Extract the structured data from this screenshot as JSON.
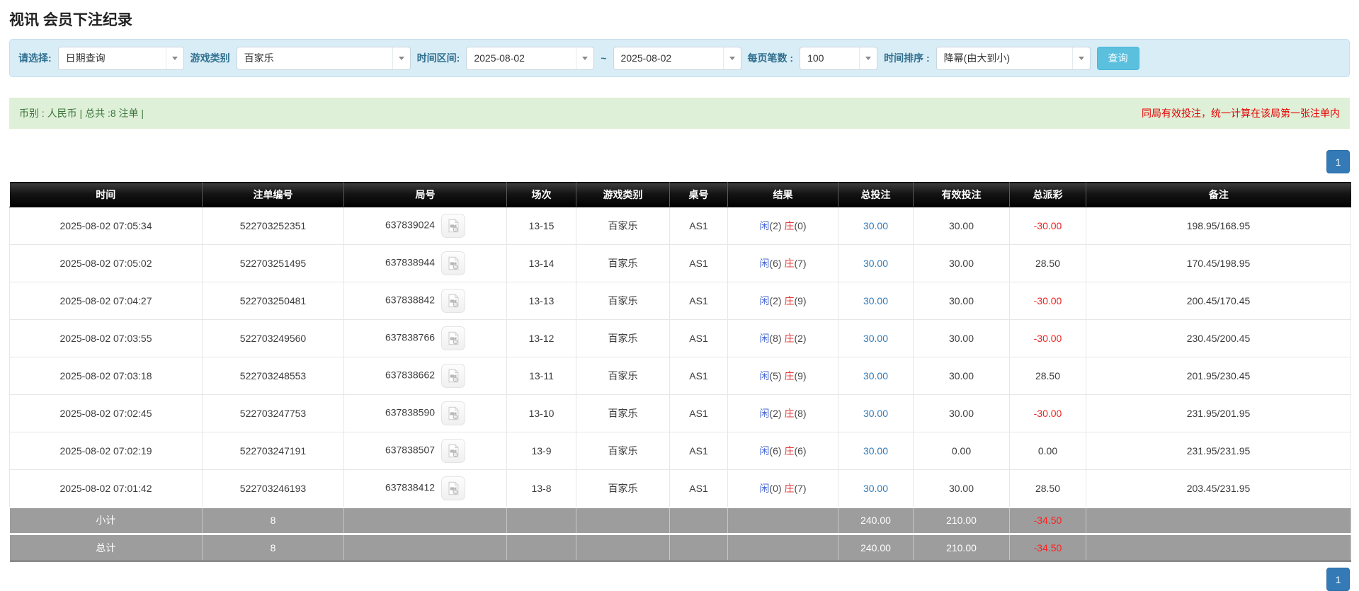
{
  "page": {
    "title": "视讯 会员下注纪录"
  },
  "filters": {
    "query_type_label": "请选择:",
    "query_type_value": "日期查询",
    "game_category_label": "游戏类别",
    "game_category_value": "百家乐",
    "time_range_label": "时间区间:",
    "date_from": "2025-08-02",
    "range_separator": "~",
    "date_to": "2025-08-02",
    "page_size_label": "每页笔数 :",
    "page_size_value": "100",
    "time_sort_label": "时间排序 :",
    "time_sort_value": "降幂(由大到小)",
    "search_button_label": "查询"
  },
  "summary_bar": {
    "left_text": "币别 : 人民币 | 总共 :8 注单 |",
    "right_notice": "同局有效投注，统一计算在该局第一张注单内"
  },
  "pagination": {
    "page": "1"
  },
  "icons": {
    "combo_arrow": "chevron-down-icon",
    "round_video": "video-file-icon"
  },
  "colors": {
    "filter_bar_bg": "#d9edf7",
    "filter_label": "#31708f",
    "search_button_bg": "#5bc0de",
    "summary_bg": "#dff0d8",
    "summary_text": "#3c763d",
    "notice_red": "#e60000",
    "header_bg": "#000000",
    "link_blue": "#337ab7",
    "player_blue": "#4466d6",
    "banker_red": "#e03b3b",
    "negative_red": "#ee2222",
    "footer_bg": "#9d9d9d",
    "pagination_blue": "#337ab7"
  },
  "table": {
    "headers": [
      "时间",
      "注单编号",
      "局号",
      "场次",
      "游戏类别",
      "桌号",
      "结果",
      "总投注",
      "有效投注",
      "总派彩",
      "备注"
    ],
    "rows": [
      {
        "time": "2025-08-02 07:05:34",
        "bet_id": "522703252351",
        "round_id": "637839024",
        "session": "13-15",
        "game": "百家乐",
        "table": "AS1",
        "player_label": "闲",
        "player_score": "(2)",
        "banker_label": "庄",
        "banker_score": "(0)",
        "total_bet": "30.00",
        "valid_bet": "30.00",
        "payout": "-30.00",
        "payout_negative": true,
        "remark": "198.95/168.95"
      },
      {
        "time": "2025-08-02 07:05:02",
        "bet_id": "522703251495",
        "round_id": "637838944",
        "session": "13-14",
        "game": "百家乐",
        "table": "AS1",
        "player_label": "闲",
        "player_score": "(6)",
        "banker_label": "庄",
        "banker_score": "(7)",
        "total_bet": "30.00",
        "valid_bet": "30.00",
        "payout": "28.50",
        "payout_negative": false,
        "remark": "170.45/198.95"
      },
      {
        "time": "2025-08-02 07:04:27",
        "bet_id": "522703250481",
        "round_id": "637838842",
        "session": "13-13",
        "game": "百家乐",
        "table": "AS1",
        "player_label": "闲",
        "player_score": "(2)",
        "banker_label": "庄",
        "banker_score": "(9)",
        "total_bet": "30.00",
        "valid_bet": "30.00",
        "payout": "-30.00",
        "payout_negative": true,
        "remark": "200.45/170.45"
      },
      {
        "time": "2025-08-02 07:03:55",
        "bet_id": "522703249560",
        "round_id": "637838766",
        "session": "13-12",
        "game": "百家乐",
        "table": "AS1",
        "player_label": "闲",
        "player_score": "(8)",
        "banker_label": "庄",
        "banker_score": "(2)",
        "total_bet": "30.00",
        "valid_bet": "30.00",
        "payout": "-30.00",
        "payout_negative": true,
        "remark": "230.45/200.45"
      },
      {
        "time": "2025-08-02 07:03:18",
        "bet_id": "522703248553",
        "round_id": "637838662",
        "session": "13-11",
        "game": "百家乐",
        "table": "AS1",
        "player_label": "闲",
        "player_score": "(5)",
        "banker_label": "庄",
        "banker_score": "(9)",
        "total_bet": "30.00",
        "valid_bet": "30.00",
        "payout": "28.50",
        "payout_negative": false,
        "remark": "201.95/230.45"
      },
      {
        "time": "2025-08-02 07:02:45",
        "bet_id": "522703247753",
        "round_id": "637838590",
        "session": "13-10",
        "game": "百家乐",
        "table": "AS1",
        "player_label": "闲",
        "player_score": "(2)",
        "banker_label": "庄",
        "banker_score": "(8)",
        "total_bet": "30.00",
        "valid_bet": "30.00",
        "payout": "-30.00",
        "payout_negative": true,
        "remark": "231.95/201.95"
      },
      {
        "time": "2025-08-02 07:02:19",
        "bet_id": "522703247191",
        "round_id": "637838507",
        "session": "13-9",
        "game": "百家乐",
        "table": "AS1",
        "player_label": "闲",
        "player_score": "(6)",
        "banker_label": "庄",
        "banker_score": "(6)",
        "total_bet": "30.00",
        "valid_bet": "0.00",
        "payout": "0.00",
        "payout_negative": false,
        "remark": "231.95/231.95"
      },
      {
        "time": "2025-08-02 07:01:42",
        "bet_id": "522703246193",
        "round_id": "637838412",
        "session": "13-8",
        "game": "百家乐",
        "table": "AS1",
        "player_label": "闲",
        "player_score": "(0)",
        "banker_label": "庄",
        "banker_score": "(7)",
        "total_bet": "30.00",
        "valid_bet": "30.00",
        "payout": "28.50",
        "payout_negative": false,
        "remark": "203.45/231.95"
      }
    ],
    "subtotal_row": {
      "label": "小计",
      "count": "8",
      "total_bet": "240.00",
      "valid_bet": "210.00",
      "payout": "-34.50"
    },
    "total_row": {
      "label": "总计",
      "count": "8",
      "total_bet": "240.00",
      "valid_bet": "210.00",
      "payout": "-34.50"
    }
  }
}
